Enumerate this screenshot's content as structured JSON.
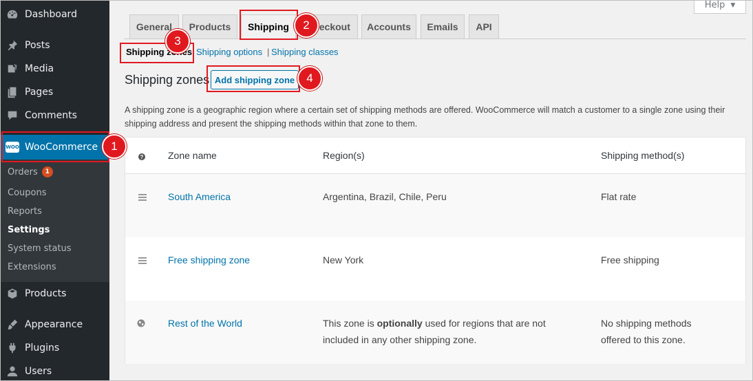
{
  "sidebar": {
    "items": [
      {
        "label": "Dashboard",
        "icon": "dashboard-icon"
      },
      {
        "label": "Posts",
        "icon": "pin-icon"
      },
      {
        "label": "Media",
        "icon": "media-icon"
      },
      {
        "label": "Pages",
        "icon": "pages-icon"
      },
      {
        "label": "Comments",
        "icon": "comment-icon"
      },
      {
        "label": "WooCommerce",
        "icon": "woo-icon",
        "logo_text": "WOO"
      },
      {
        "label": "Products",
        "icon": "box-icon"
      },
      {
        "label": "Appearance",
        "icon": "brush-icon"
      },
      {
        "label": "Plugins",
        "icon": "plugin-icon"
      },
      {
        "label": "Users",
        "icon": "user-icon"
      }
    ],
    "submenu": [
      {
        "label": "Orders",
        "badge": "1"
      },
      {
        "label": "Coupons"
      },
      {
        "label": "Reports"
      },
      {
        "label": "Settings"
      },
      {
        "label": "System status"
      },
      {
        "label": "Extensions"
      }
    ]
  },
  "help": {
    "label": "Help",
    "arrow": "▼"
  },
  "tabs": [
    "General",
    "Products",
    "Shipping",
    "Checkout",
    "Accounts",
    "Emails",
    "API"
  ],
  "subnav": {
    "zones": "Shipping zones",
    "options": "Shipping options",
    "classes": "Shipping classes",
    "sep": "|"
  },
  "page_title": "Shipping zones",
  "add_button": "Add shipping zone",
  "description": "A shipping zone is a geographic region where a certain set of shipping methods are offered. WooCommerce will match a customer to a single zone using their shipping address and present the shipping methods within that zone to them.",
  "table": {
    "help_glyph": "?",
    "headers": {
      "zone": "Zone name",
      "regions": "Region(s)",
      "methods": "Shipping method(s)"
    },
    "rows": [
      {
        "zone": "South America",
        "regions": "Argentina, Brazil, Chile, Peru",
        "methods": "Flat rate"
      },
      {
        "zone": "Free shipping zone",
        "regions": "New York",
        "methods": "Free shipping"
      }
    ],
    "rest": {
      "zone": "Rest of the World",
      "regions_pre": "This zone is ",
      "regions_bold": "optionally",
      "regions_post": " used for regions that are not included in any other shipping zone.",
      "methods": "No shipping methods offered to this zone."
    }
  },
  "callouts": [
    "1",
    "2",
    "3",
    "4"
  ],
  "colors": {
    "accent": "#0073aa",
    "sidebar": "#23282d",
    "highlight": "#e0191f",
    "badge": "#d54e21"
  }
}
